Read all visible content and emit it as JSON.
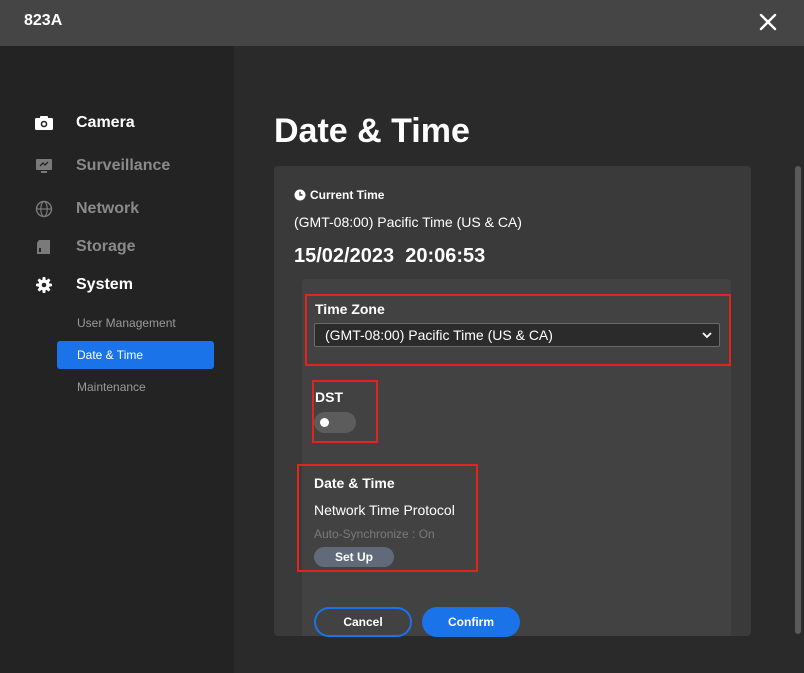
{
  "app": {
    "title": "823A"
  },
  "sidebar": {
    "items": [
      {
        "label": "Camera",
        "icon": "camera-icon"
      },
      {
        "label": "Surveillance",
        "icon": "monitor-icon"
      },
      {
        "label": "Network",
        "icon": "globe-icon"
      },
      {
        "label": "Storage",
        "icon": "storage-icon"
      },
      {
        "label": "System",
        "icon": "gear-icon"
      }
    ],
    "sub_items": [
      {
        "label": "User Management"
      },
      {
        "label": "Date & Time",
        "selected": true
      },
      {
        "label": "Maintenance"
      }
    ]
  },
  "main": {
    "title": "Date & Time",
    "current_time": {
      "heading": "Current Time",
      "zone": "(GMT-08:00) Pacific Time (US & CA)",
      "date": "15/02/2023",
      "time": "20:06:53"
    },
    "time_zone": {
      "label": "Time Zone",
      "selected": "(GMT-08:00) Pacific Time (US & CA)"
    },
    "dst": {
      "label": "DST",
      "enabled": false
    },
    "date_time": {
      "label": "Date & Time",
      "method": "Network Time Protocol",
      "auto_sync": "Auto-Synchronize :  On",
      "setup_label": "Set Up"
    },
    "actions": {
      "cancel": "Cancel",
      "confirm": "Confirm"
    }
  },
  "colors": {
    "accent": "#1a73e8",
    "highlight": "#e3231f",
    "background": "#2a2a2a"
  }
}
